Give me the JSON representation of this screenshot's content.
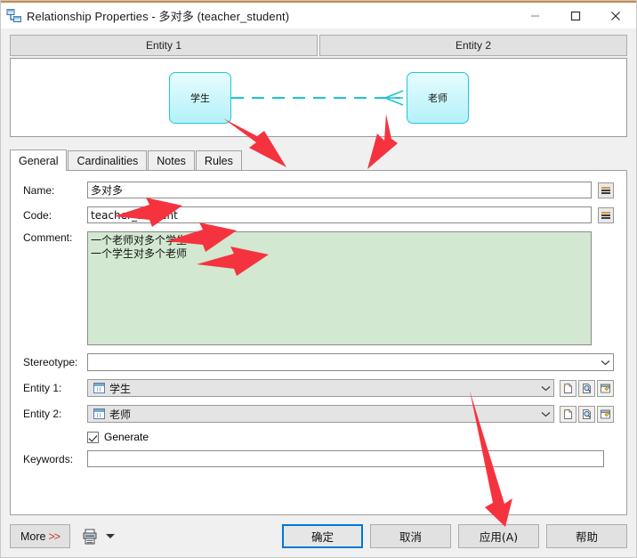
{
  "window": {
    "title": "Relationship Properties - 多对多 (teacher_student)",
    "icon": "relationship-icon",
    "controls": {
      "minimize": "minimize-icon",
      "maximize": "maximize-icon",
      "close": "close-icon"
    }
  },
  "entity_headers": [
    {
      "label": "Entity 1"
    },
    {
      "label": "Entity 2"
    }
  ],
  "diagram": {
    "left_entity": "学生",
    "right_entity": "老师",
    "link_color": "#19c6d6",
    "link_style": "dashed",
    "right_end_symbol": "crows-foot"
  },
  "tabs": [
    {
      "label": "General",
      "active": true
    },
    {
      "label": "Cardinalities",
      "active": false
    },
    {
      "label": "Notes",
      "active": false
    },
    {
      "label": "Rules",
      "active": false
    }
  ],
  "form": {
    "name": {
      "label": "Name:",
      "value": "多对多"
    },
    "code": {
      "label": "Code:",
      "value": "teacher_student"
    },
    "comment": {
      "label": "Comment:",
      "value": "一个老师对多个学生\n一个学生对多个老师"
    },
    "stereotype": {
      "label": "Stereotype:",
      "value": "",
      "placeholder": ""
    },
    "entity1": {
      "label": "Entity 1:",
      "value": "学生"
    },
    "entity2": {
      "label": "Entity 2:",
      "value": "老师"
    },
    "generate": {
      "label": "Generate",
      "checked": true
    },
    "keywords": {
      "label": "Keywords:",
      "value": "",
      "placeholder": ""
    },
    "equals_button_title": "=",
    "entity_buttons": [
      "create-icon",
      "properties-icon",
      "open-icon"
    ]
  },
  "footer": {
    "more": "More",
    "more_chevrons": ">>",
    "print_icon": "printer-icon",
    "dropdown_icon": "chevron-down-icon",
    "ok": "确定",
    "cancel": "取消",
    "apply": "应用(A)",
    "help": "帮助"
  },
  "annotations": {
    "accent_color": "#f5333f",
    "arrows": [
      "points-to-student-entity-box",
      "points-to-teacher-entity-box",
      "points-to-name-field",
      "points-to-code-field",
      "points-to-comment-field",
      "points-to-apply-button"
    ]
  },
  "colors": {
    "title_accent": "#c98a4b",
    "comment_bg": "#d3e8d1",
    "entity_fill": "#c9f6fb",
    "entity_border": "#1fc8d8",
    "default_button_border": "#0078d7"
  }
}
